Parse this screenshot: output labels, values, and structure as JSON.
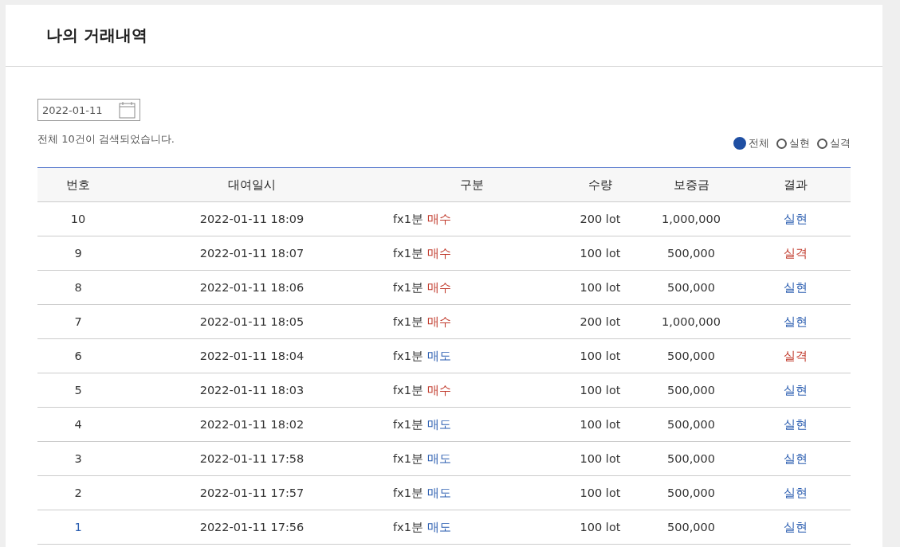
{
  "page": {
    "title": "나의 거래내역"
  },
  "date_field": {
    "value": "2022-01-11"
  },
  "result_count": "전체 10건이 검색되었습니다.",
  "filters": [
    {
      "label": "전체",
      "selected": true
    },
    {
      "label": "실현",
      "selected": false
    },
    {
      "label": "실격",
      "selected": false
    }
  ],
  "table": {
    "columns": [
      "번호",
      "대여일시",
      "구분",
      "수량",
      "보증금",
      "결과"
    ],
    "rows": [
      {
        "no": "10",
        "datetime": "2022-01-11 18:09",
        "product": "fx1분",
        "side": {
          "label": "매수",
          "kind": "buy"
        },
        "quantity": "200 lot",
        "deposit": "1,000,000",
        "result": {
          "label": "실현",
          "kind": "realized"
        },
        "highlighted": false
      },
      {
        "no": "9",
        "datetime": "2022-01-11 18:07",
        "product": "fx1분",
        "side": {
          "label": "매수",
          "kind": "buy"
        },
        "quantity": "100 lot",
        "deposit": "500,000",
        "result": {
          "label": "실격",
          "kind": "failed"
        },
        "highlighted": false
      },
      {
        "no": "8",
        "datetime": "2022-01-11 18:06",
        "product": "fx1분",
        "side": {
          "label": "매수",
          "kind": "buy"
        },
        "quantity": "100 lot",
        "deposit": "500,000",
        "result": {
          "label": "실현",
          "kind": "realized"
        },
        "highlighted": false
      },
      {
        "no": "7",
        "datetime": "2022-01-11 18:05",
        "product": "fx1분",
        "side": {
          "label": "매수",
          "kind": "buy"
        },
        "quantity": "200 lot",
        "deposit": "1,000,000",
        "result": {
          "label": "실현",
          "kind": "realized"
        },
        "highlighted": false
      },
      {
        "no": "6",
        "datetime": "2022-01-11 18:04",
        "product": "fx1분",
        "side": {
          "label": "매도",
          "kind": "sell"
        },
        "quantity": "100 lot",
        "deposit": "500,000",
        "result": {
          "label": "실격",
          "kind": "failed"
        },
        "highlighted": false
      },
      {
        "no": "5",
        "datetime": "2022-01-11 18:03",
        "product": "fx1분",
        "side": {
          "label": "매수",
          "kind": "buy"
        },
        "quantity": "100 lot",
        "deposit": "500,000",
        "result": {
          "label": "실현",
          "kind": "realized"
        },
        "highlighted": false
      },
      {
        "no": "4",
        "datetime": "2022-01-11 18:02",
        "product": "fx1분",
        "side": {
          "label": "매도",
          "kind": "sell"
        },
        "quantity": "100 lot",
        "deposit": "500,000",
        "result": {
          "label": "실현",
          "kind": "realized"
        },
        "highlighted": false
      },
      {
        "no": "3",
        "datetime": "2022-01-11 17:58",
        "product": "fx1분",
        "side": {
          "label": "매도",
          "kind": "sell"
        },
        "quantity": "100 lot",
        "deposit": "500,000",
        "result": {
          "label": "실현",
          "kind": "realized"
        },
        "highlighted": false
      },
      {
        "no": "2",
        "datetime": "2022-01-11 17:57",
        "product": "fx1분",
        "side": {
          "label": "매도",
          "kind": "sell"
        },
        "quantity": "100 lot",
        "deposit": "500,000",
        "result": {
          "label": "실현",
          "kind": "realized"
        },
        "highlighted": false
      },
      {
        "no": "1",
        "datetime": "2022-01-11 17:56",
        "product": "fx1분",
        "side": {
          "label": "매도",
          "kind": "sell"
        },
        "quantity": "100 lot",
        "deposit": "500,000",
        "result": {
          "label": "실현",
          "kind": "realized"
        },
        "highlighted": true
      }
    ]
  }
}
